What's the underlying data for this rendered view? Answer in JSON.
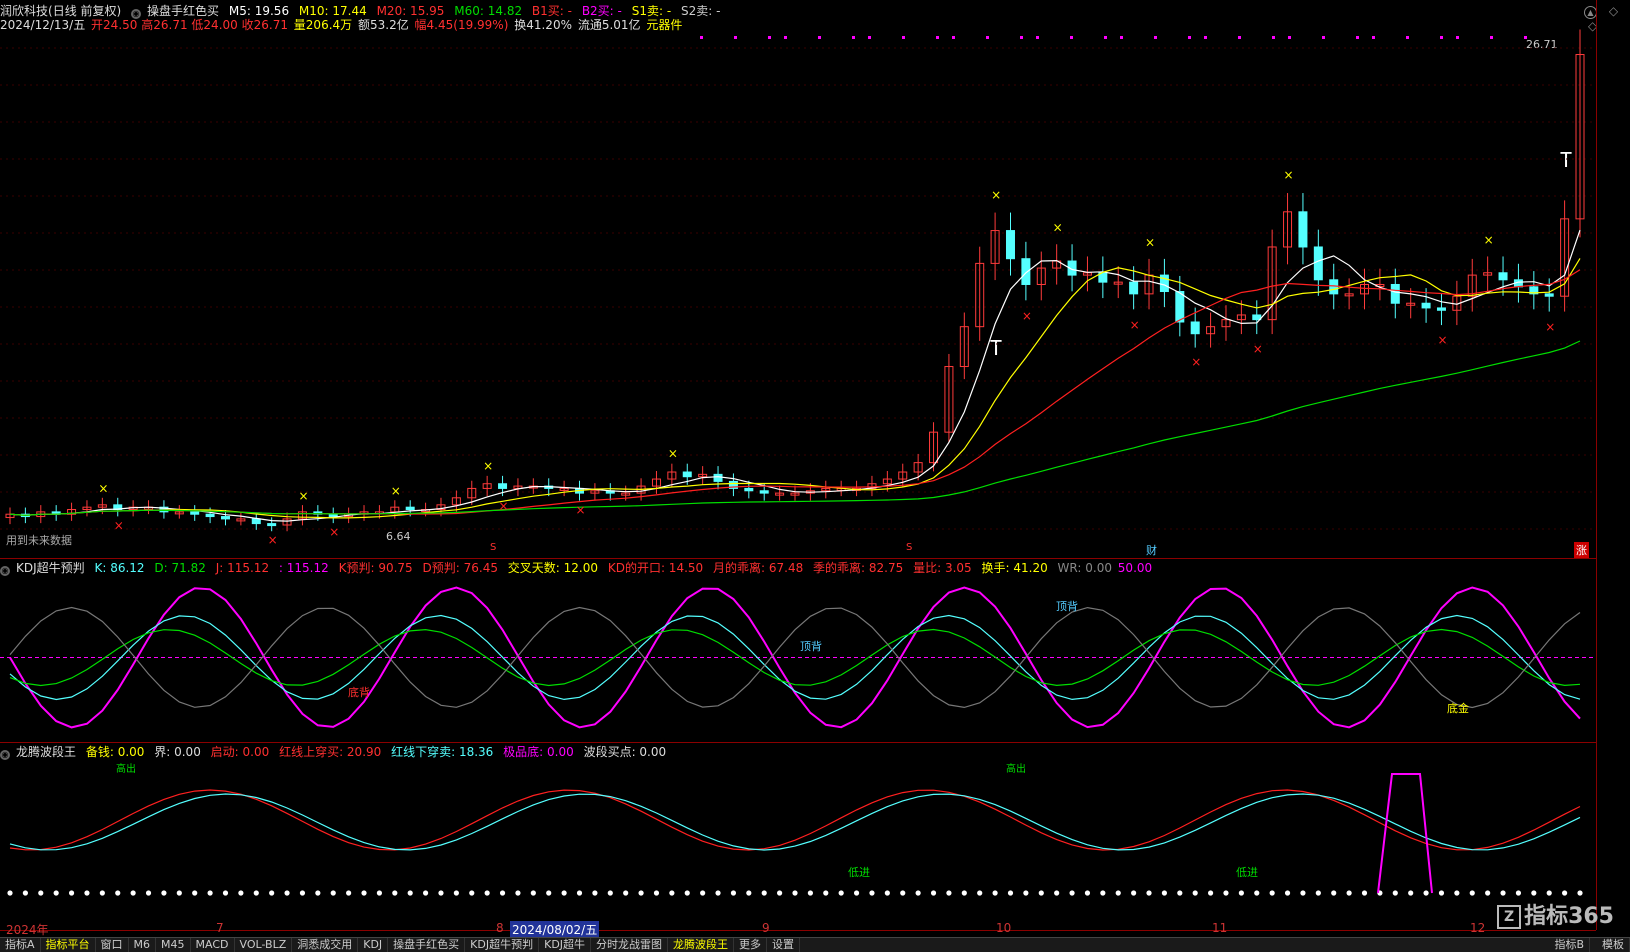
{
  "colors": {
    "up": "#ff3b3b",
    "down": "#54ffff",
    "ma5": "#ffffff",
    "ma10": "#ffff00",
    "ma20": "#ff2020",
    "ma60": "#00dd00",
    "panel_sep": "#8b0000",
    "magenta": "#ff00ff"
  },
  "main": {
    "security": "润欣科技",
    "period": "(日线 前复权)",
    "indicator": "操盘手红色买",
    "ma5": "M5: 19.56",
    "ma10": "M10: 17.44",
    "ma20": "M20: 15.95",
    "ma60": "M60: 14.82",
    "b1": "B1买: -",
    "b2": "B2买: -",
    "s1": "S1卖: -",
    "s2": "S2卖: -",
    "date": "2024/12/13/五",
    "open": "开24.50",
    "high": "高26.71",
    "low": "低24.00",
    "close": "收26.71",
    "volume": "量206.4万",
    "amount": "额53.2亿",
    "change": "幅4.45(19.99%)",
    "turnover": "换41.20%",
    "float": "流通5.01亿",
    "sector": "元器件",
    "future_note": "用到未来数据",
    "price_high": "26.71",
    "price_low": "6.64",
    "marker_cai": "财",
    "marker_zhang": "涨",
    "marker_s": "S",
    "marker_t": "T"
  },
  "kdj": {
    "title": "KDJ超牛预判",
    "k": "K: 86.12",
    "d": "D: 71.82",
    "j": "J: 115.12",
    "j2": ": 115.12",
    "kpred": "K预判: 90.75",
    "dpred": "D预判: 76.45",
    "cross_days": "交叉天数: 12.00",
    "kd_open": "KD的开口: 14.50",
    "month_dev": "月的乖离: 67.48",
    "season_dev": "季的乖离: 82.75",
    "vol_ratio": "量比: 3.05",
    "turn": "换手: 41.20",
    "wr": "WR: 0.00",
    "wr2": "50.00",
    "lbl_top1": "顶背",
    "lbl_top2": "顶背",
    "lbl_top3": "顶背",
    "lbl_bottom": "底金",
    "lbl_dibei": "底背"
  },
  "wave": {
    "title": "龙腾波段王",
    "reserve": "备钱: 0.00",
    "bound": "界: 0.00",
    "start": "启动: 0.00",
    "red_up": "红线上穿买: 20.90",
    "blue_down": "红线下穿卖: 18.36",
    "extreme": "极品底: 0.00",
    "wave_buy": "波段买点: 0.00",
    "lbl_lowin1": "低进",
    "lbl_lowin2": "低进",
    "lbl_sell1": "高出",
    "lbl_sell2": "高出"
  },
  "months": [
    "2024年",
    "7",
    "8",
    "2024/08/02/五",
    "9",
    "10",
    "11",
    "12"
  ],
  "tabs": [
    "指标A",
    "指标平台",
    "窗口",
    "M6",
    "M45",
    "MACD",
    "VOL-BLZ",
    "洞悉成交用",
    "KDJ",
    "操盘手红色买",
    "KDJ超牛预判",
    "KDJ超牛",
    "分时龙战雷图",
    "龙腾波段王",
    "更多",
    "设置"
  ],
  "watermark": "指标365",
  "right_labels": [
    "指标B",
    "模板"
  ],
  "chart_data": {
    "type": "candlestick",
    "note_units": "price (CNY)",
    "price_range_visible": [
      6.64,
      26.71
    ],
    "candles_close": [
      7.1,
      7.0,
      7.2,
      7.1,
      7.3,
      7.4,
      7.5,
      7.3,
      7.4,
      7.4,
      7.2,
      7.2,
      7.1,
      7.0,
      6.9,
      6.9,
      6.7,
      6.64,
      6.9,
      7.2,
      7.1,
      7.0,
      7.1,
      7.2,
      7.2,
      7.4,
      7.3,
      7.3,
      7.5,
      7.8,
      8.2,
      8.4,
      8.2,
      8.3,
      8.3,
      8.2,
      8.2,
      8.0,
      8.1,
      8.0,
      8.0,
      8.3,
      8.6,
      8.9,
      8.7,
      8.8,
      8.5,
      8.2,
      8.1,
      8.0,
      8.0,
      8.0,
      8.1,
      8.2,
      8.2,
      8.2,
      8.4,
      8.6,
      8.9,
      9.3,
      10.6,
      13.4,
      15.1,
      17.8,
      19.2,
      18.0,
      16.9,
      17.6,
      17.9,
      17.3,
      17.4,
      17.0,
      17.0,
      16.5,
      17.3,
      16.6,
      15.3,
      14.8,
      15.1,
      15.4,
      15.6,
      15.4,
      18.5,
      20.0,
      18.5,
      17.1,
      16.5,
      16.5,
      16.9,
      16.9,
      16.1,
      16.1,
      15.9,
      15.8,
      16.4,
      17.3,
      17.4,
      17.1,
      16.8,
      16.5,
      16.4,
      19.7,
      26.71
    ],
    "ma5_last": 19.56,
    "ma10_last": 17.44,
    "ma20_last": 15.95,
    "ma60_last": 14.82
  }
}
